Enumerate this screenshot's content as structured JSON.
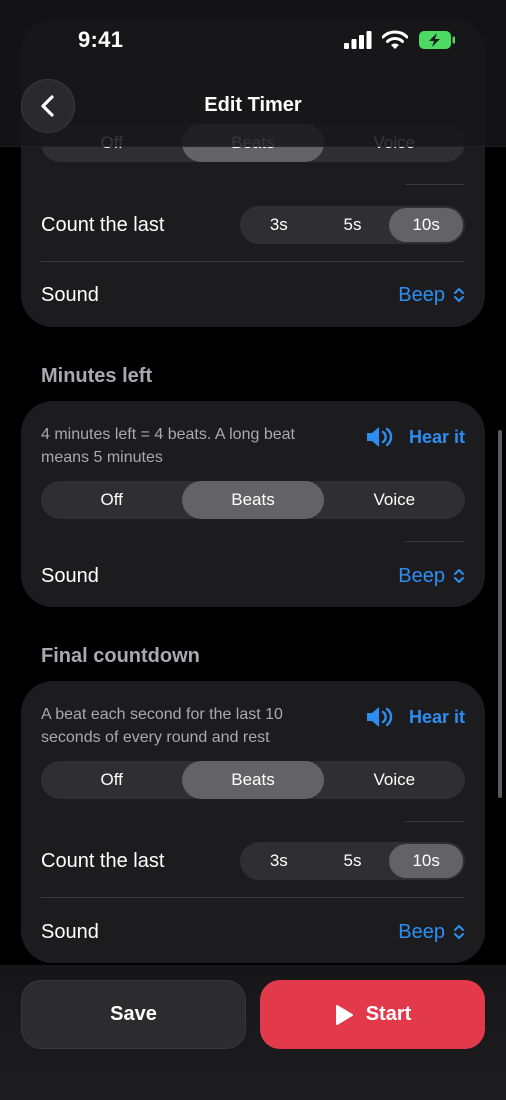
{
  "status_bar": {
    "time": "9:41"
  },
  "nav": {
    "title": "Edit Timer"
  },
  "top_card": {
    "segment": [
      "Off",
      "Beats",
      "Voice"
    ],
    "count_label": "Count the last",
    "count_options": [
      "3s",
      "5s",
      "10s"
    ],
    "sound_label": "Sound",
    "sound_value": "Beep"
  },
  "minutes_left": {
    "title": "Minutes left",
    "description": "4 minutes left = 4 beats. A long beat means 5 minutes",
    "hear_label": "Hear it",
    "segment": [
      "Off",
      "Beats",
      "Voice"
    ],
    "selected": "Beats",
    "sound_label": "Sound",
    "sound_value": "Beep"
  },
  "final_countdown": {
    "title": "Final countdown",
    "description": "A beat each second for the last 10 seconds of every round and rest",
    "hear_label": "Hear it",
    "segment": [
      "Off",
      "Beats",
      "Voice"
    ],
    "selected": "Beats",
    "count_label": "Count the last",
    "count_options": [
      "3s",
      "5s",
      "10s"
    ],
    "count_selected": "10s",
    "sound_label": "Sound",
    "sound_value": "Beep"
  },
  "actions": {
    "save": "Save",
    "start": "Start"
  },
  "colors": {
    "accent": "#2d8ef2",
    "start": "#e23a4b"
  }
}
